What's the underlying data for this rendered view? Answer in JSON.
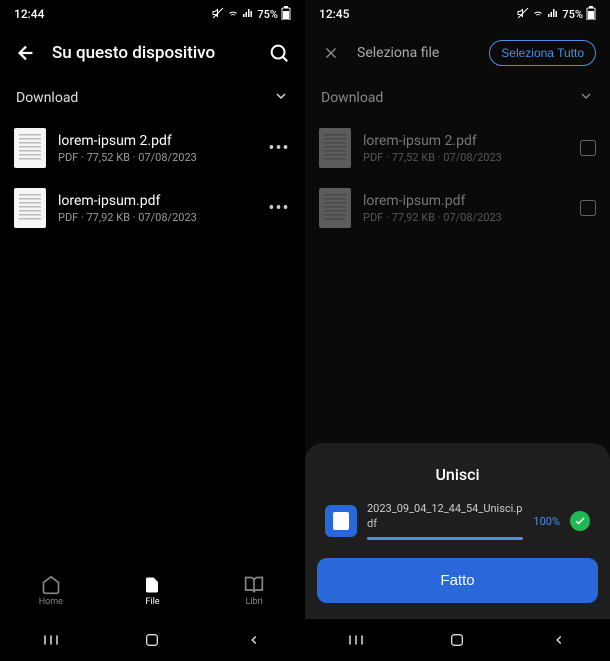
{
  "left": {
    "statusTime": "12:44",
    "battery": "75%",
    "headerTitle": "Su questo dispositivo",
    "section": "Download",
    "files": [
      {
        "name": "lorem-ipsum 2.pdf",
        "meta": "PDF · 77,52 KB · 07/08/2023"
      },
      {
        "name": "lorem-ipsum.pdf",
        "meta": "PDF · 77,92 KB · 07/08/2023"
      }
    ],
    "nav": {
      "home": "Home",
      "file": "File",
      "libri": "Libri"
    }
  },
  "right": {
    "statusTime": "12:45",
    "battery": "75%",
    "headerTitle": "Seleziona file",
    "selectAll": "Seleziona Tutto",
    "section": "Download",
    "files": [
      {
        "name": "lorem-ipsum 2.pdf",
        "meta": "PDF · 77,52 KB · 07/08/2023"
      },
      {
        "name": "lorem-ipsum.pdf",
        "meta": "PDF · 77,92 KB · 07/08/2023"
      }
    ],
    "sheet": {
      "title": "Unisci",
      "filename": "2023_09_04_12_44_54_Unisci.pdf",
      "percent": "100%",
      "done": "Fatto"
    }
  }
}
